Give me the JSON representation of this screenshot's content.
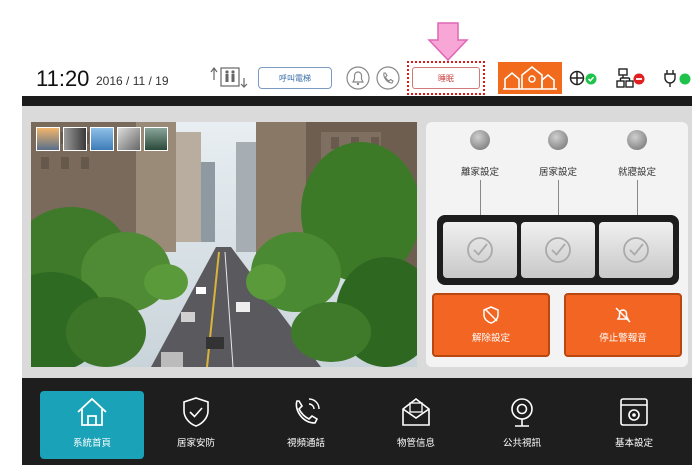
{
  "status": {
    "time": "11:20",
    "date": "2016 / 11 / 19",
    "elevator_call_label": "呼叫電梯",
    "sleep_label": "睡眠",
    "icons": [
      "elevator-icon",
      "bell-icon",
      "phone-call-icon",
      "home-mode-icon",
      "network-ok-icon",
      "lan-error-icon",
      "power-ok-icon"
    ],
    "colors": {
      "accent": "#f26522",
      "ok": "#1fc24b",
      "error": "#e02020",
      "highlight": "#e0191b",
      "nav_active": "#1aa3b8"
    }
  },
  "control": {
    "modes": [
      {
        "label": "離家設定"
      },
      {
        "label": "居家設定"
      },
      {
        "label": "就寢設定"
      }
    ],
    "disarm_label": "解除設定",
    "stop_alarm_label": "停止警報音"
  },
  "nav": {
    "items": [
      {
        "label": "系統首頁",
        "icon": "home-icon",
        "active": true
      },
      {
        "label": "居家安防",
        "icon": "shield-icon",
        "active": false
      },
      {
        "label": "視頻通話",
        "icon": "phone-icon",
        "active": false
      },
      {
        "label": "物管信息",
        "icon": "mail-icon",
        "active": false
      },
      {
        "label": "公共視訊",
        "icon": "webcam-icon",
        "active": false
      },
      {
        "label": "基本設定",
        "icon": "settings-icon",
        "active": false
      }
    ]
  }
}
